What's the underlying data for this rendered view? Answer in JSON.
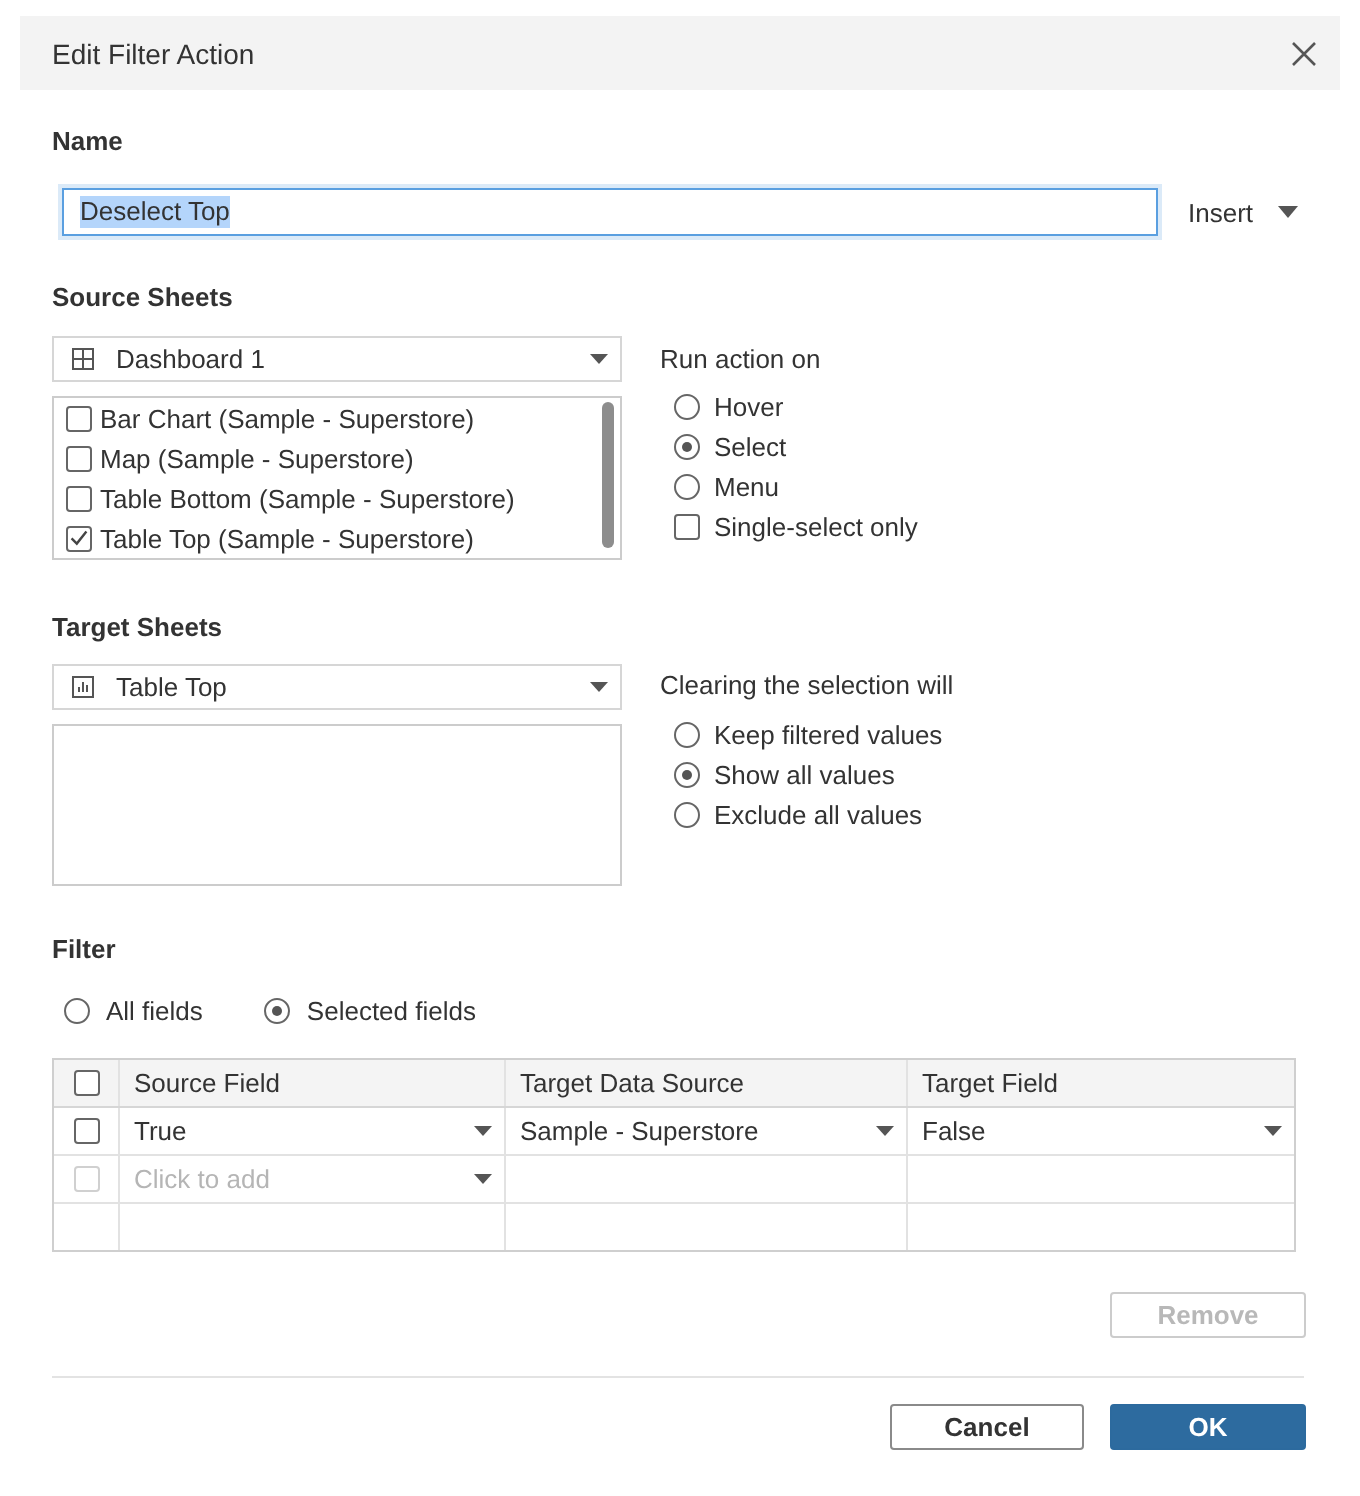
{
  "dialog": {
    "title": "Edit Filter Action"
  },
  "name": {
    "label": "Name",
    "value": "Deselect Top",
    "focused": true,
    "text_selected": true,
    "insert_label": "Insert"
  },
  "source_sheets": {
    "label": "Source Sheets",
    "dropdown": "Dashboard 1",
    "sheets": [
      {
        "label": "Bar Chart (Sample - Superstore)",
        "checked": false
      },
      {
        "label": "Map (Sample - Superstore)",
        "checked": false
      },
      {
        "label": "Table Bottom (Sample - Superstore)",
        "checked": false
      },
      {
        "label": "Table Top (Sample - Superstore)",
        "checked": true
      }
    ]
  },
  "run_action_on": {
    "label": "Run action on",
    "options": [
      {
        "label": "Hover",
        "selected": false
      },
      {
        "label": "Select",
        "selected": true
      },
      {
        "label": "Menu",
        "selected": false
      }
    ],
    "single_select_only": {
      "label": "Single-select only",
      "checked": false
    }
  },
  "target_sheets": {
    "label": "Target Sheets",
    "dropdown": "Table Top"
  },
  "clearing_selection": {
    "label": "Clearing the selection will",
    "options": [
      {
        "label": "Keep filtered values",
        "selected": false
      },
      {
        "label": "Show all values",
        "selected": true
      },
      {
        "label": "Exclude all values",
        "selected": false
      }
    ]
  },
  "filter": {
    "label": "Filter",
    "scope": [
      {
        "label": "All fields",
        "selected": false
      },
      {
        "label": "Selected fields",
        "selected": true
      }
    ],
    "table": {
      "select_all_checked": false,
      "columns": [
        "Source Field",
        "Target Data Source",
        "Target Field"
      ],
      "rows": [
        {
          "kind": "mapping",
          "checked": false,
          "cells": [
            "True",
            "Sample - Superstore",
            "False"
          ]
        },
        {
          "kind": "add",
          "placeholder": "Click to add",
          "disabled": true
        }
      ]
    }
  },
  "buttons": {
    "remove": {
      "label": "Remove",
      "disabled": true
    },
    "footer": [
      {
        "label": "Cancel",
        "kind": "secondary"
      },
      {
        "label": "OK",
        "kind": "primary"
      }
    ]
  }
}
